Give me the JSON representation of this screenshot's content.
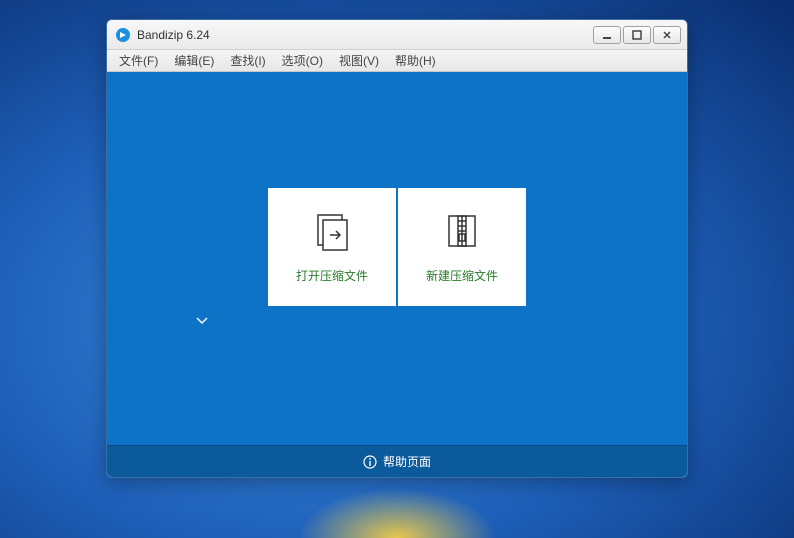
{
  "titlebar": {
    "title": "Bandizip 6.24"
  },
  "menu": {
    "items": [
      "文件(F)",
      "编辑(E)",
      "查找(I)",
      "选项(O)",
      "视图(V)",
      "帮助(H)"
    ]
  },
  "cards": {
    "open": {
      "label": "打开压缩文件"
    },
    "new": {
      "label": "新建压缩文件"
    }
  },
  "footer": {
    "help_label": "帮助页面"
  }
}
